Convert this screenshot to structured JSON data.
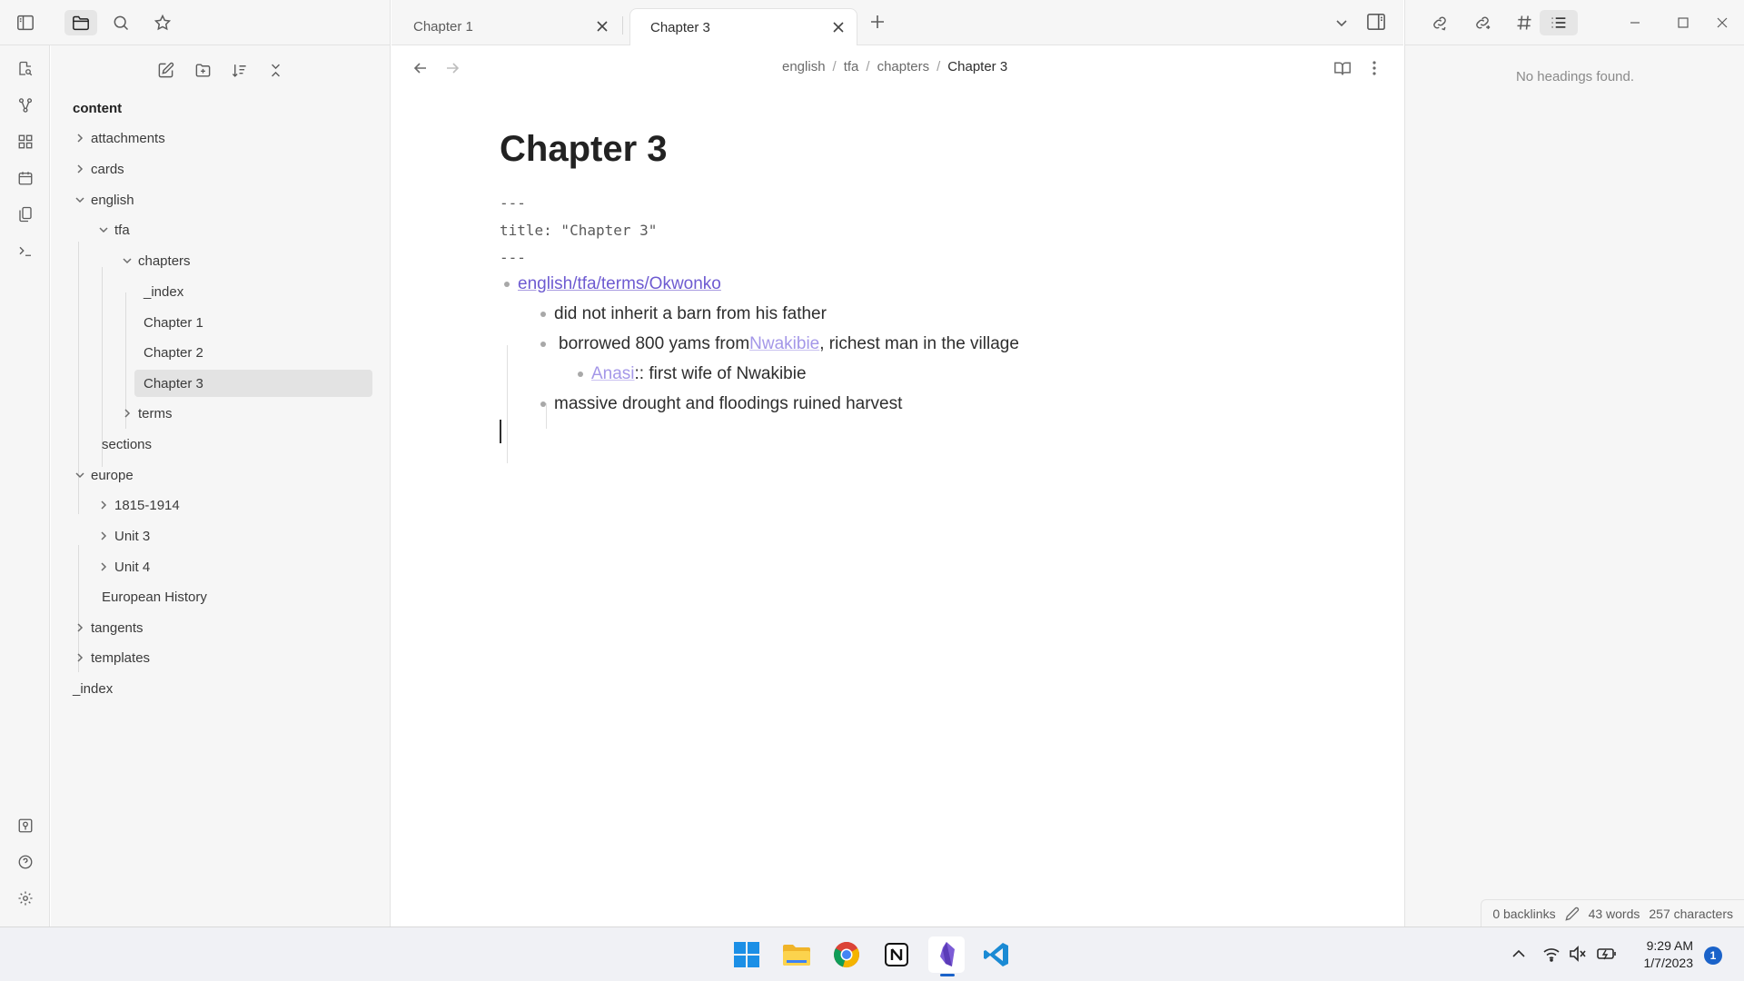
{
  "sidebar": {
    "root_label": "content",
    "tree": [
      {
        "label": "attachments"
      },
      {
        "label": "cards"
      },
      {
        "label": "english"
      },
      {
        "label": "tfa"
      },
      {
        "label": "chapters"
      },
      {
        "label": "_index"
      },
      {
        "label": "Chapter 1"
      },
      {
        "label": "Chapter 2"
      },
      {
        "label": "Chapter 3"
      },
      {
        "label": "terms"
      },
      {
        "label": "sections"
      },
      {
        "label": "europe"
      },
      {
        "label": "1815-1914"
      },
      {
        "label": "Unit 3"
      },
      {
        "label": "Unit 4"
      },
      {
        "label": "European History"
      },
      {
        "label": "tangents"
      },
      {
        "label": "templates"
      },
      {
        "label": "_index"
      }
    ]
  },
  "tabs": [
    {
      "label": "Chapter 1"
    },
    {
      "label": "Chapter 3"
    }
  ],
  "breadcrumb": {
    "p1": "english",
    "p2": "tfa",
    "p3": "chapters",
    "current": "Chapter 3",
    "sep": "/"
  },
  "document": {
    "title": "Chapter 3",
    "frontmatter": {
      "open": "---",
      "title_line": "title: \"Chapter 3\"",
      "close": "---"
    },
    "root_link": "english/tfa/terms/Okwonko",
    "item1": "did not inherit a barn from his father",
    "item2_prefix": "borrowed 800 yams from ",
    "item2_link": "Nwakibie",
    "item2_suffix": ", richest man in the village",
    "item3_link": "Anasi",
    "item3_suffix": " :: first wife of Nwakibie",
    "item4": "massive drought and floodings ruined harvest"
  },
  "outline": {
    "empty_text": "No headings found."
  },
  "status_bar": {
    "backlinks": "0 backlinks",
    "words": "43 words",
    "characters": "257 characters"
  },
  "taskbar": {
    "time": "9:29 AM",
    "date": "1/7/2023",
    "notification_count": "1"
  },
  "colors": {
    "accent": "#6e5bd1",
    "unresolved_link": "#a497e8",
    "selected_bg": "#e3e3e3"
  }
}
